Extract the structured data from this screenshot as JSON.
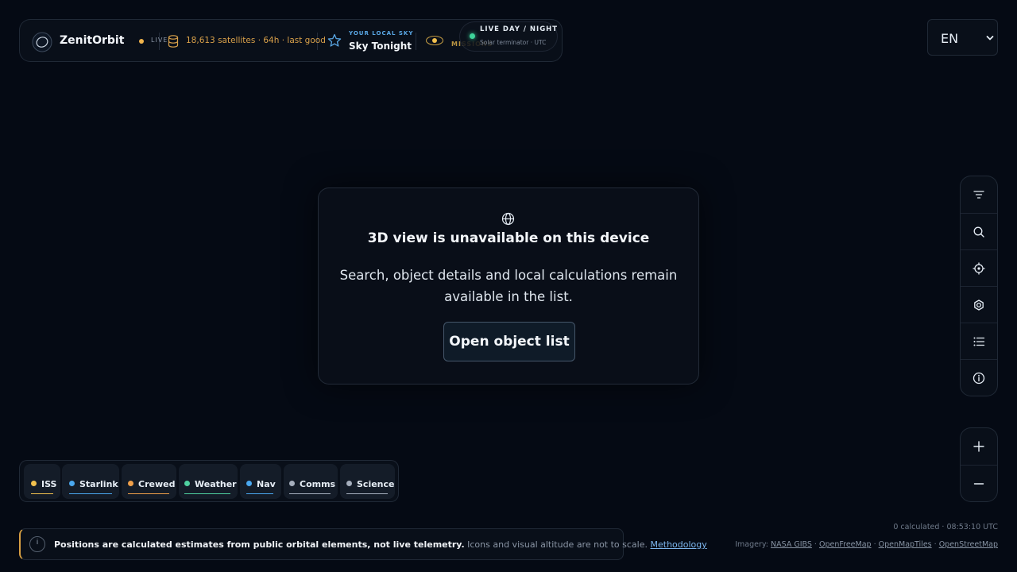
{
  "header": {
    "brand_name": "ZenitOrbit",
    "live_label": "LIVE",
    "satellites_status": "18,613 satellites · 64h · last good",
    "local_sky_label": "YOUR LOCAL SKY",
    "local_sky_title": "Sky Tonight",
    "missions_label": "MISSIONS",
    "daynight_title": "LIVE DAY / NIGHT",
    "daynight_subtitle": "Solar terminator · UTC",
    "colors": {
      "accent_gold": "#d9a14a",
      "accent_blue": "#5aa8e6",
      "live_green": "#3ed39a"
    }
  },
  "language": {
    "selected": "EN"
  },
  "unavailable_card": {
    "icon": "globe-icon",
    "title": "3D view is unavailable on this device",
    "body": "Search, object details and local calculations remain available in the list.",
    "button_label": "Open object list"
  },
  "toolbar": {
    "items": [
      {
        "name": "filter",
        "icon": "filter-icon"
      },
      {
        "name": "search",
        "icon": "search-icon"
      },
      {
        "name": "locate",
        "icon": "crosshair-icon"
      },
      {
        "name": "view",
        "icon": "eye-icon"
      },
      {
        "name": "list",
        "icon": "list-icon"
      },
      {
        "name": "info",
        "icon": "info-icon"
      }
    ],
    "zoom": [
      {
        "name": "zoom-in",
        "icon": "plus-icon"
      },
      {
        "name": "zoom-out",
        "icon": "minus-icon"
      }
    ]
  },
  "categories": [
    {
      "label": "ISS",
      "color": "#f2c14e"
    },
    {
      "label": "Starlink",
      "color": "#4aa8f0"
    },
    {
      "label": "Crewed",
      "color": "#f0a04a"
    },
    {
      "label": "Weather",
      "color": "#4fd1a0"
    },
    {
      "label": "Nav",
      "color": "#4aa8f0"
    },
    {
      "label": "Comms",
      "color": "#a6afbd"
    },
    {
      "label": "Science",
      "color": "#a6afbd"
    }
  ],
  "disclaimer": {
    "bold": "Positions are calculated estimates from public orbital elements, not live telemetry.",
    "normal": "Icons and visual altitude are not to scale.",
    "link": "Methodology"
  },
  "footer": {
    "calculated": "0 calculated · 08:53:10 UTC",
    "imagery_label": "Imagery:",
    "sources": [
      "NASA GIBS",
      "OpenFreeMap",
      "OpenMapTiles",
      "OpenStreetMap"
    ]
  }
}
